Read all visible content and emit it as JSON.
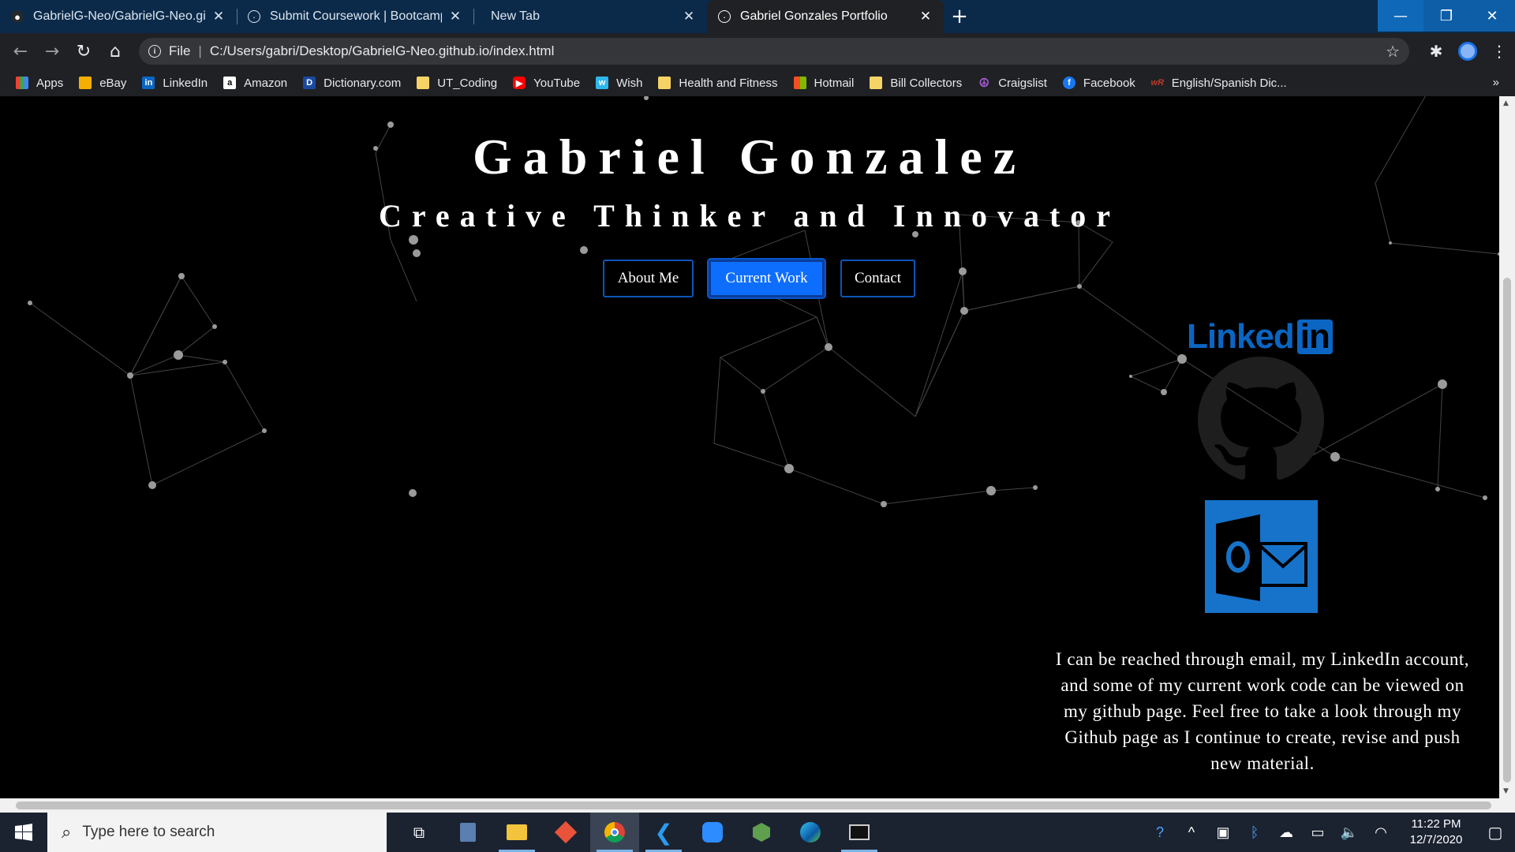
{
  "tabs": [
    {
      "title": "GabrielG-Neo/GabrielG-Neo.gith",
      "icon": "github-icon",
      "active": false
    },
    {
      "title": "Submit Coursework | Bootcamp S",
      "icon": "globe-icon",
      "active": false
    },
    {
      "title": "New Tab",
      "icon": "",
      "active": false
    },
    {
      "title": "Gabriel Gonzales Portfolio",
      "icon": "globe-icon",
      "active": true
    }
  ],
  "address": {
    "scheme": "File",
    "url": "C:/Users/gabri/Desktop/GabrielG-Neo.github.io/index.html"
  },
  "bookmarks": [
    {
      "label": "Apps",
      "color": "#ea4335"
    },
    {
      "label": "eBay",
      "color": "#e53238"
    },
    {
      "label": "LinkedIn",
      "color": "#0a66c2"
    },
    {
      "label": "Amazon",
      "color": "#ffffff"
    },
    {
      "label": "Dictionary.com",
      "color": "#1a4aa0"
    },
    {
      "label": "UT_Coding",
      "color": "#f6d365"
    },
    {
      "label": "YouTube",
      "color": "#ff0000"
    },
    {
      "label": "Wish",
      "color": "#2fb7ec"
    },
    {
      "label": "Health and Fitness",
      "color": "#f6d365"
    },
    {
      "label": "Hotmail",
      "color": "#f25022"
    },
    {
      "label": "Bill Collectors",
      "color": "#f6d365"
    },
    {
      "label": "Craigslist",
      "color": "#7b2fa0"
    },
    {
      "label": "Facebook",
      "color": "#1877f2"
    },
    {
      "label": "English/Spanish Dic...",
      "color": "#c0392b"
    }
  ],
  "bookmark_more": "»",
  "hero": {
    "name": "Gabriel Gonzalez",
    "tagline": "Creative Thinker and Innovator"
  },
  "nav": {
    "about": "About Me",
    "work": "Current Work",
    "contact": "Contact"
  },
  "social": {
    "linkedin_word": "Linked",
    "linkedin_in": "in"
  },
  "contact_text": "I can be reached through email, my LinkedIn account, and some of my current work code can be viewed on my github page. Feel free to take a look through my Github page as I continue to create, revise and push new material.",
  "taskbar": {
    "search_placeholder": "Type here to search",
    "time": "11:22 PM",
    "date": "12/7/2020"
  },
  "colors": {
    "accent": "#0d6efd",
    "linkedin": "#0a66c2",
    "outlook": "#1673c9"
  }
}
